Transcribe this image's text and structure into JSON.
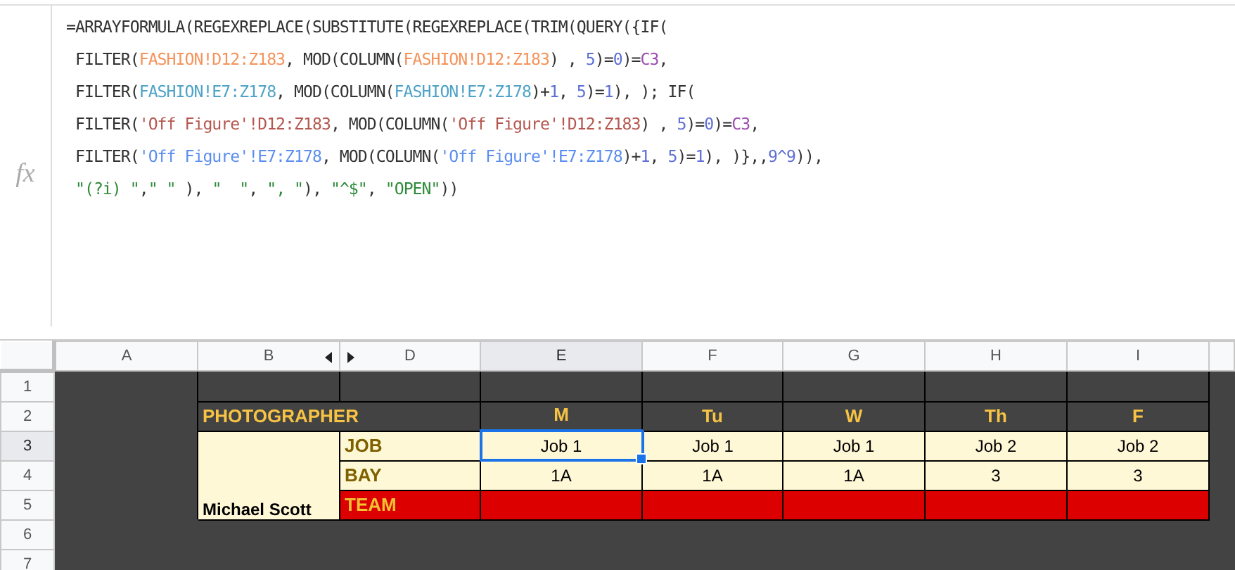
{
  "formula_bar": {
    "fx_label": "fx",
    "lines": [
      [
        {
          "kind": "plain",
          "text": "=ARRAYFORMULA(REGEXREPLACE(SUBSTITUTE(REGEXREPLACE(TRIM(QUERY({IF("
        }
      ],
      [
        {
          "kind": "plain",
          "text": " FILTER("
        },
        {
          "kind": "range1",
          "text": "FASHION!D12:Z183"
        },
        {
          "kind": "plain",
          "text": ", MOD(COLUMN("
        },
        {
          "kind": "range1",
          "text": "FASHION!D12:Z183"
        },
        {
          "kind": "plain",
          "text": ") , "
        },
        {
          "kind": "number",
          "text": "5"
        },
        {
          "kind": "plain",
          "text": ")="
        },
        {
          "kind": "number",
          "text": "0"
        },
        {
          "kind": "plain",
          "text": ")="
        },
        {
          "kind": "ref",
          "text": "C3"
        },
        {
          "kind": "plain",
          "text": ","
        }
      ],
      [
        {
          "kind": "plain",
          "text": " FILTER("
        },
        {
          "kind": "range2",
          "text": "FASHION!E7:Z178"
        },
        {
          "kind": "plain",
          "text": ", MOD(COLUMN("
        },
        {
          "kind": "range2",
          "text": "FASHION!E7:Z178"
        },
        {
          "kind": "plain",
          "text": ")+"
        },
        {
          "kind": "number",
          "text": "1"
        },
        {
          "kind": "plain",
          "text": ", "
        },
        {
          "kind": "number",
          "text": "5"
        },
        {
          "kind": "plain",
          "text": ")="
        },
        {
          "kind": "number",
          "text": "1"
        },
        {
          "kind": "plain",
          "text": "), ); IF("
        }
      ],
      [
        {
          "kind": "plain",
          "text": " FILTER("
        },
        {
          "kind": "range3",
          "text": "'Off Figure'!D12:Z183"
        },
        {
          "kind": "plain",
          "text": ", MOD(COLUMN("
        },
        {
          "kind": "range3",
          "text": "'Off Figure'!D12:Z183"
        },
        {
          "kind": "plain",
          "text": ") , "
        },
        {
          "kind": "number",
          "text": "5"
        },
        {
          "kind": "plain",
          "text": ")="
        },
        {
          "kind": "number",
          "text": "0"
        },
        {
          "kind": "plain",
          "text": ")="
        },
        {
          "kind": "ref",
          "text": "C3"
        },
        {
          "kind": "plain",
          "text": ","
        }
      ],
      [
        {
          "kind": "plain",
          "text": " FILTER("
        },
        {
          "kind": "range4",
          "text": "'Off Figure'!E7:Z178"
        },
        {
          "kind": "plain",
          "text": ", MOD(COLUMN("
        },
        {
          "kind": "range4",
          "text": "'Off Figure'!E7:Z178"
        },
        {
          "kind": "plain",
          "text": ")+"
        },
        {
          "kind": "number",
          "text": "1"
        },
        {
          "kind": "plain",
          "text": ", "
        },
        {
          "kind": "number",
          "text": "5"
        },
        {
          "kind": "plain",
          "text": ")="
        },
        {
          "kind": "number",
          "text": "1"
        },
        {
          "kind": "plain",
          "text": "), )},,"
        },
        {
          "kind": "number",
          "text": "9^9"
        },
        {
          "kind": "plain",
          "text": ")),"
        }
      ],
      [
        {
          "kind": "string",
          "text": " \"(?i) \""
        },
        {
          "kind": "plain",
          "text": ","
        },
        {
          "kind": "string",
          "text": "\" \""
        },
        {
          "kind": "plain",
          "text": " ), "
        },
        {
          "kind": "string",
          "text": "\"  \""
        },
        {
          "kind": "plain",
          "text": ", "
        },
        {
          "kind": "string",
          "text": "\", \""
        },
        {
          "kind": "plain",
          "text": "), "
        },
        {
          "kind": "string",
          "text": "\"^$\""
        },
        {
          "kind": "plain",
          "text": ", "
        },
        {
          "kind": "string",
          "text": "\"OPEN\""
        },
        {
          "kind": "plain",
          "text": "))"
        }
      ]
    ]
  },
  "columns": [
    {
      "label": "A",
      "selected": false
    },
    {
      "label": "B",
      "selected": false
    },
    {
      "label": "D",
      "selected": false
    },
    {
      "label": "E",
      "selected": true
    },
    {
      "label": "F",
      "selected": false
    },
    {
      "label": "G",
      "selected": false
    },
    {
      "label": "H",
      "selected": false
    },
    {
      "label": "I",
      "selected": false
    }
  ],
  "rows": [
    {
      "label": "1",
      "selected": false,
      "cells": [
        {
          "kind": "dark",
          "selected": false
        },
        {
          "kind": "dark",
          "selected": false
        },
        {
          "kind": "dark",
          "selected": false
        },
        {
          "kind": "dark",
          "selected": false
        },
        {
          "kind": "dark",
          "selected": false
        },
        {
          "kind": "dark",
          "selected": false
        },
        {
          "kind": "dark",
          "selected": false
        }
      ]
    },
    {
      "label": "2",
      "selected": false,
      "cells": [
        {
          "kind": "title",
          "text": "PHOTOGRAPHER",
          "colspan": 2,
          "selected": false
        },
        {
          "kind": "day",
          "text": "M",
          "selected": false
        },
        {
          "kind": "day",
          "text": "Tu",
          "selected": false
        },
        {
          "kind": "day",
          "text": "W",
          "selected": false
        },
        {
          "kind": "day",
          "text": "Th",
          "selected": false
        },
        {
          "kind": "day",
          "text": "F",
          "selected": false
        }
      ]
    },
    {
      "label": "3",
      "selected": true,
      "cells": [
        {
          "kind": "name",
          "text": "Michael Scott",
          "rowspan": 3,
          "selected": false
        },
        {
          "kind": "label",
          "text": "JOB",
          "selected": false
        },
        {
          "kind": "value",
          "text": "Job 1",
          "selected": true
        },
        {
          "kind": "value",
          "text": "Job 1",
          "selected": false
        },
        {
          "kind": "value",
          "text": "Job 1",
          "selected": false
        },
        {
          "kind": "value",
          "text": "Job 2",
          "selected": false
        },
        {
          "kind": "value",
          "text": "Job 2",
          "selected": false
        }
      ]
    },
    {
      "label": "4",
      "selected": false,
      "cells": [
        {
          "kind": "label",
          "text": "BAY",
          "selected": false
        },
        {
          "kind": "value",
          "text": "1A",
          "selected": false
        },
        {
          "kind": "value",
          "text": "1A",
          "selected": false
        },
        {
          "kind": "value",
          "text": "1A",
          "selected": false
        },
        {
          "kind": "value",
          "text": "3",
          "selected": false
        },
        {
          "kind": "value",
          "text": "3",
          "selected": false
        }
      ]
    },
    {
      "label": "5",
      "selected": false,
      "cells": [
        {
          "kind": "team",
          "text": "TEAM",
          "selected": false
        },
        {
          "kind": "red",
          "selected": false
        },
        {
          "kind": "red",
          "selected": false
        },
        {
          "kind": "red",
          "selected": false
        },
        {
          "kind": "red",
          "selected": false
        },
        {
          "kind": "red",
          "selected": false
        }
      ]
    },
    {
      "label": "6",
      "selected": false
    },
    {
      "label": "7",
      "selected": false
    }
  ]
}
